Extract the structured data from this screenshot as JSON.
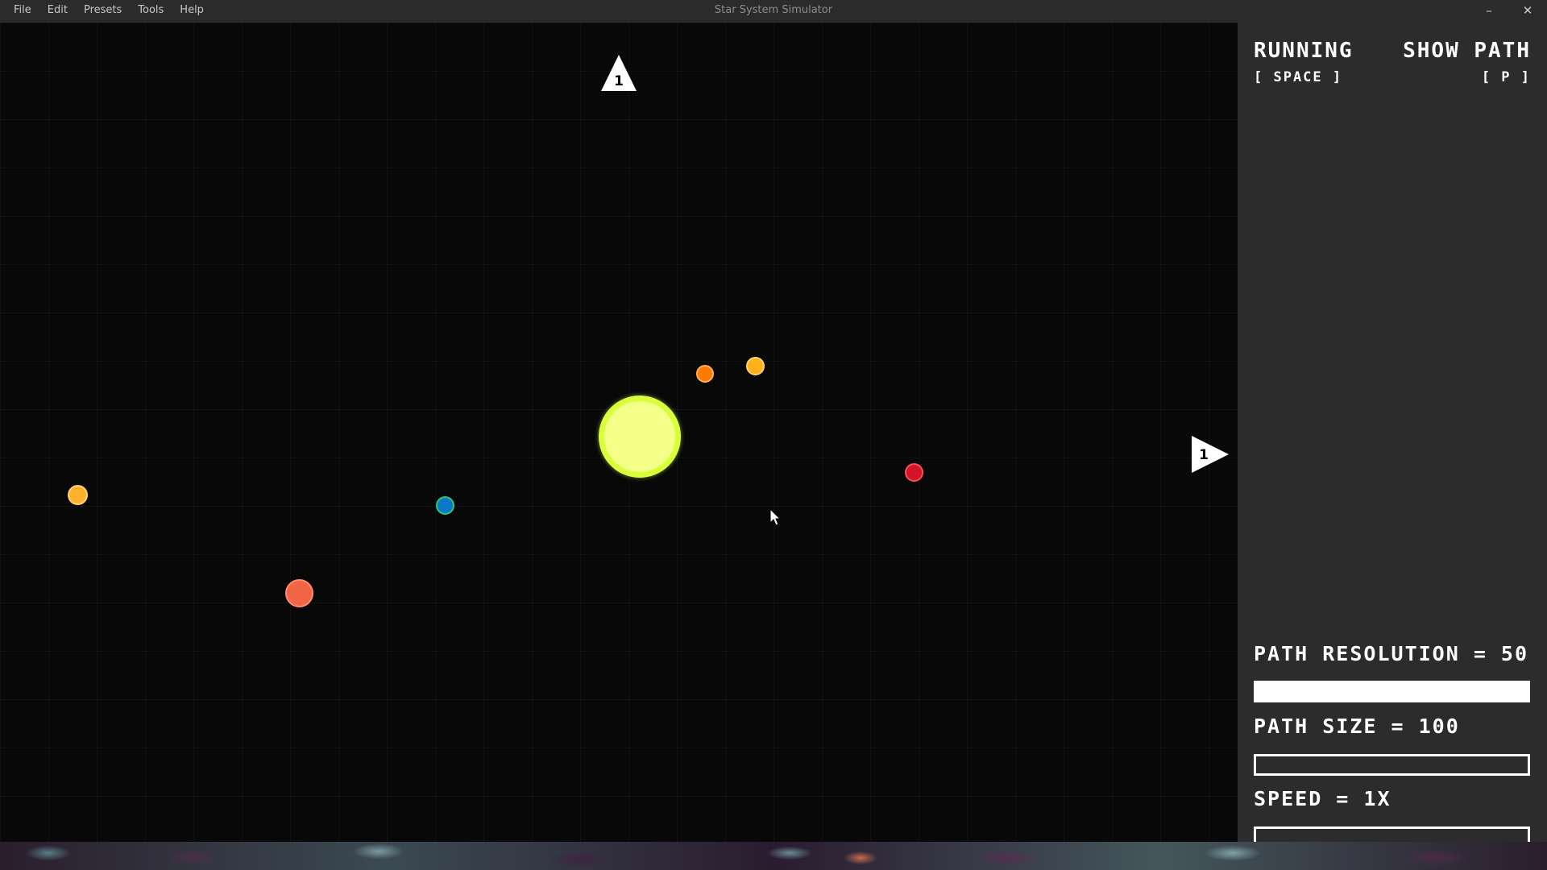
{
  "window": {
    "title": "Star System Simulator",
    "menu": [
      {
        "label": "File"
      },
      {
        "label": "Edit"
      },
      {
        "label": "Presets"
      },
      {
        "label": "Tools"
      },
      {
        "label": "Help"
      }
    ],
    "controls": {
      "minimize": "–",
      "close": "✕"
    }
  },
  "simulation": {
    "markers": {
      "top": {
        "label": "1",
        "direction": "up"
      },
      "right": {
        "label": "1",
        "direction": "right"
      }
    },
    "bodies": [
      {
        "name": "star",
        "fill": "#f4ff8a",
        "ring": "#d8ff39"
      },
      {
        "name": "planet-orange-1",
        "fill": "#ff7a00"
      },
      {
        "name": "planet-orange-2",
        "fill": "#ffb11a"
      },
      {
        "name": "planet-red",
        "fill": "#d0142a"
      },
      {
        "name": "planet-blue",
        "fill": "#0b79c8",
        "ring": "#34c66a"
      },
      {
        "name": "planet-yellow",
        "fill": "#ffb02e"
      },
      {
        "name": "planet-salmon",
        "fill": "#f26546"
      }
    ]
  },
  "panel": {
    "running": {
      "title": "RUNNING",
      "key": "[ SPACE ]"
    },
    "show_path": {
      "title": "SHOW PATH",
      "key": "[ P ]"
    },
    "sliders": {
      "path_resolution": {
        "label": "PATH RESOLUTION = 50",
        "fill": 1.0
      },
      "path_size": {
        "label": "PATH SIZE = 100",
        "fill": 0.0
      },
      "speed": {
        "label": "SPEED = 1X",
        "fill": 0.0
      }
    }
  },
  "colors": {
    "canvas_bg": "#080808",
    "panel_bg": "#2c2c2c",
    "titlebar_bg": "#2b2b2b",
    "text": "#ffffff"
  }
}
